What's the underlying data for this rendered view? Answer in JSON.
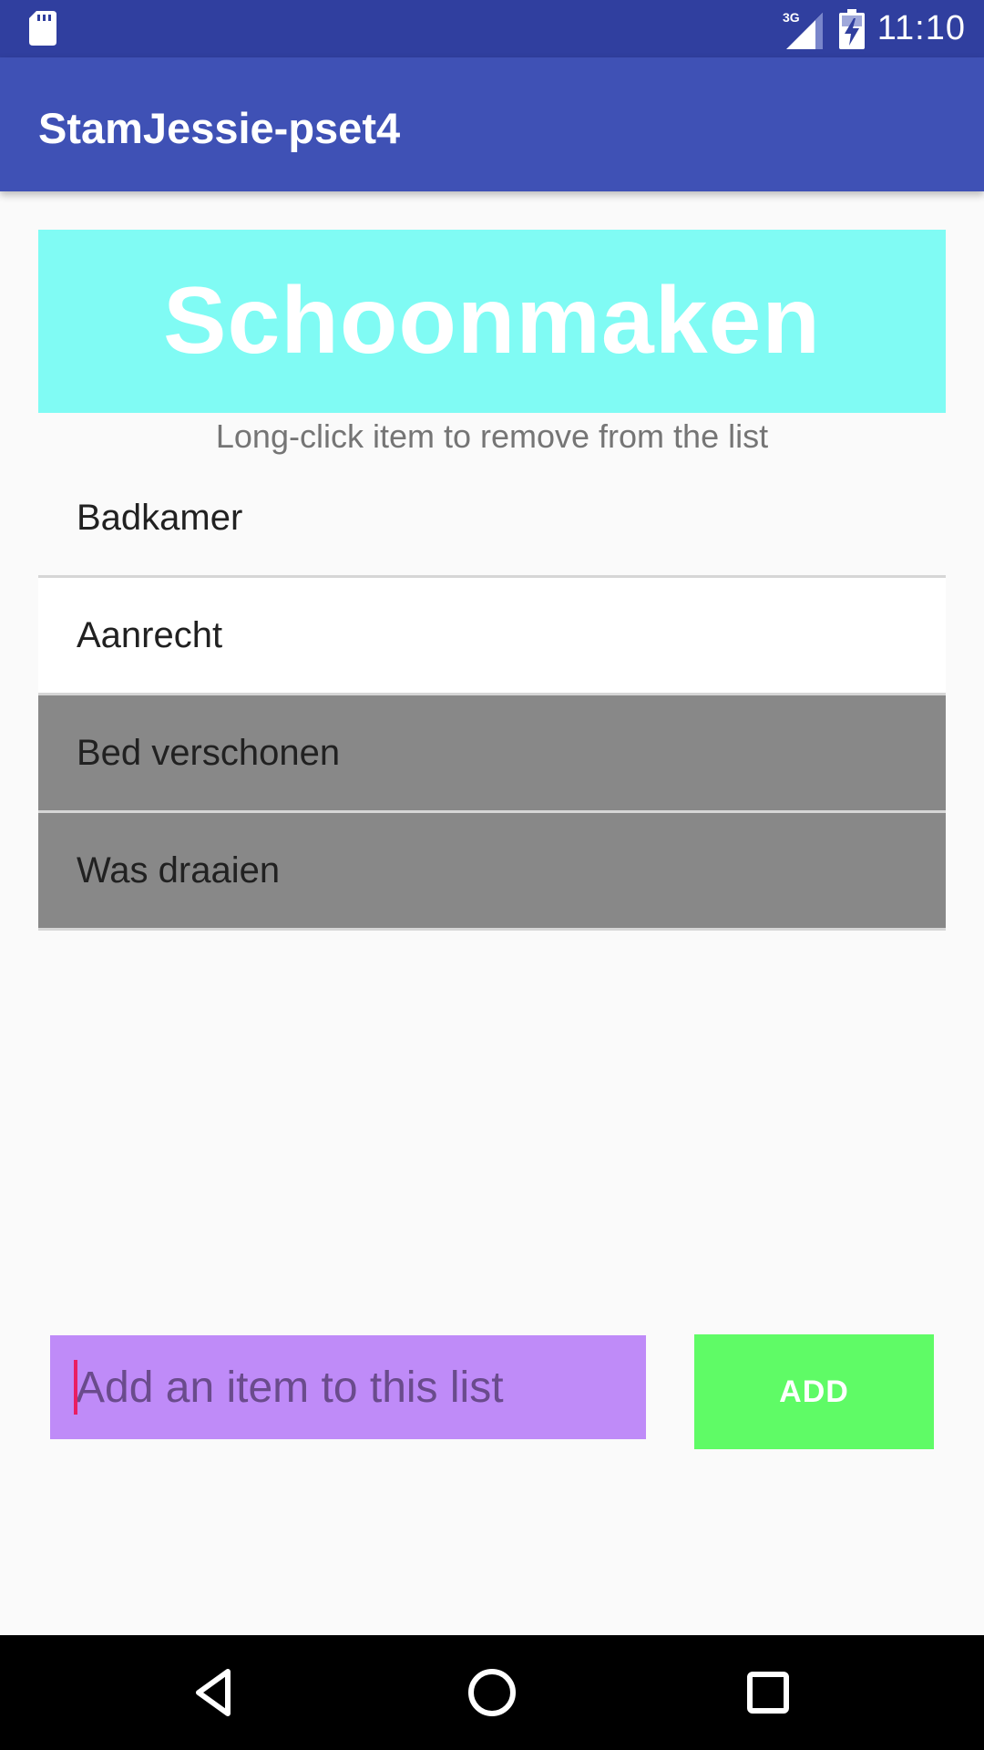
{
  "status_bar": {
    "network_type": "3G",
    "time": "11:10",
    "icons": [
      "sd-card-icon",
      "signal-icon",
      "battery-charging-icon"
    ]
  },
  "app_bar": {
    "title": "StamJessie-pset4"
  },
  "list": {
    "title": "Schoonmaken",
    "hint": "Long-click item to remove from the list",
    "items": [
      {
        "label": "Badkamer",
        "state": "default"
      },
      {
        "label": "Aanrecht",
        "state": "highlighted"
      },
      {
        "label": "Bed verschonen",
        "state": "done"
      },
      {
        "label": "Was draaien",
        "state": "done"
      }
    ]
  },
  "input": {
    "value": "",
    "placeholder": "Add an item to this list"
  },
  "add_button": {
    "label": "ADD"
  },
  "nav_bar": {
    "icons": [
      "back-icon",
      "home-icon",
      "recents-icon"
    ]
  },
  "colors": {
    "status_bar": "#303f9f",
    "app_bar": "#3f51b5",
    "banner": "#80fbf4",
    "input_bg": "#bf8bf8",
    "add_button_bg": "#5ffb66",
    "done_item_bg": "#888888",
    "caret": "#e91e63"
  }
}
